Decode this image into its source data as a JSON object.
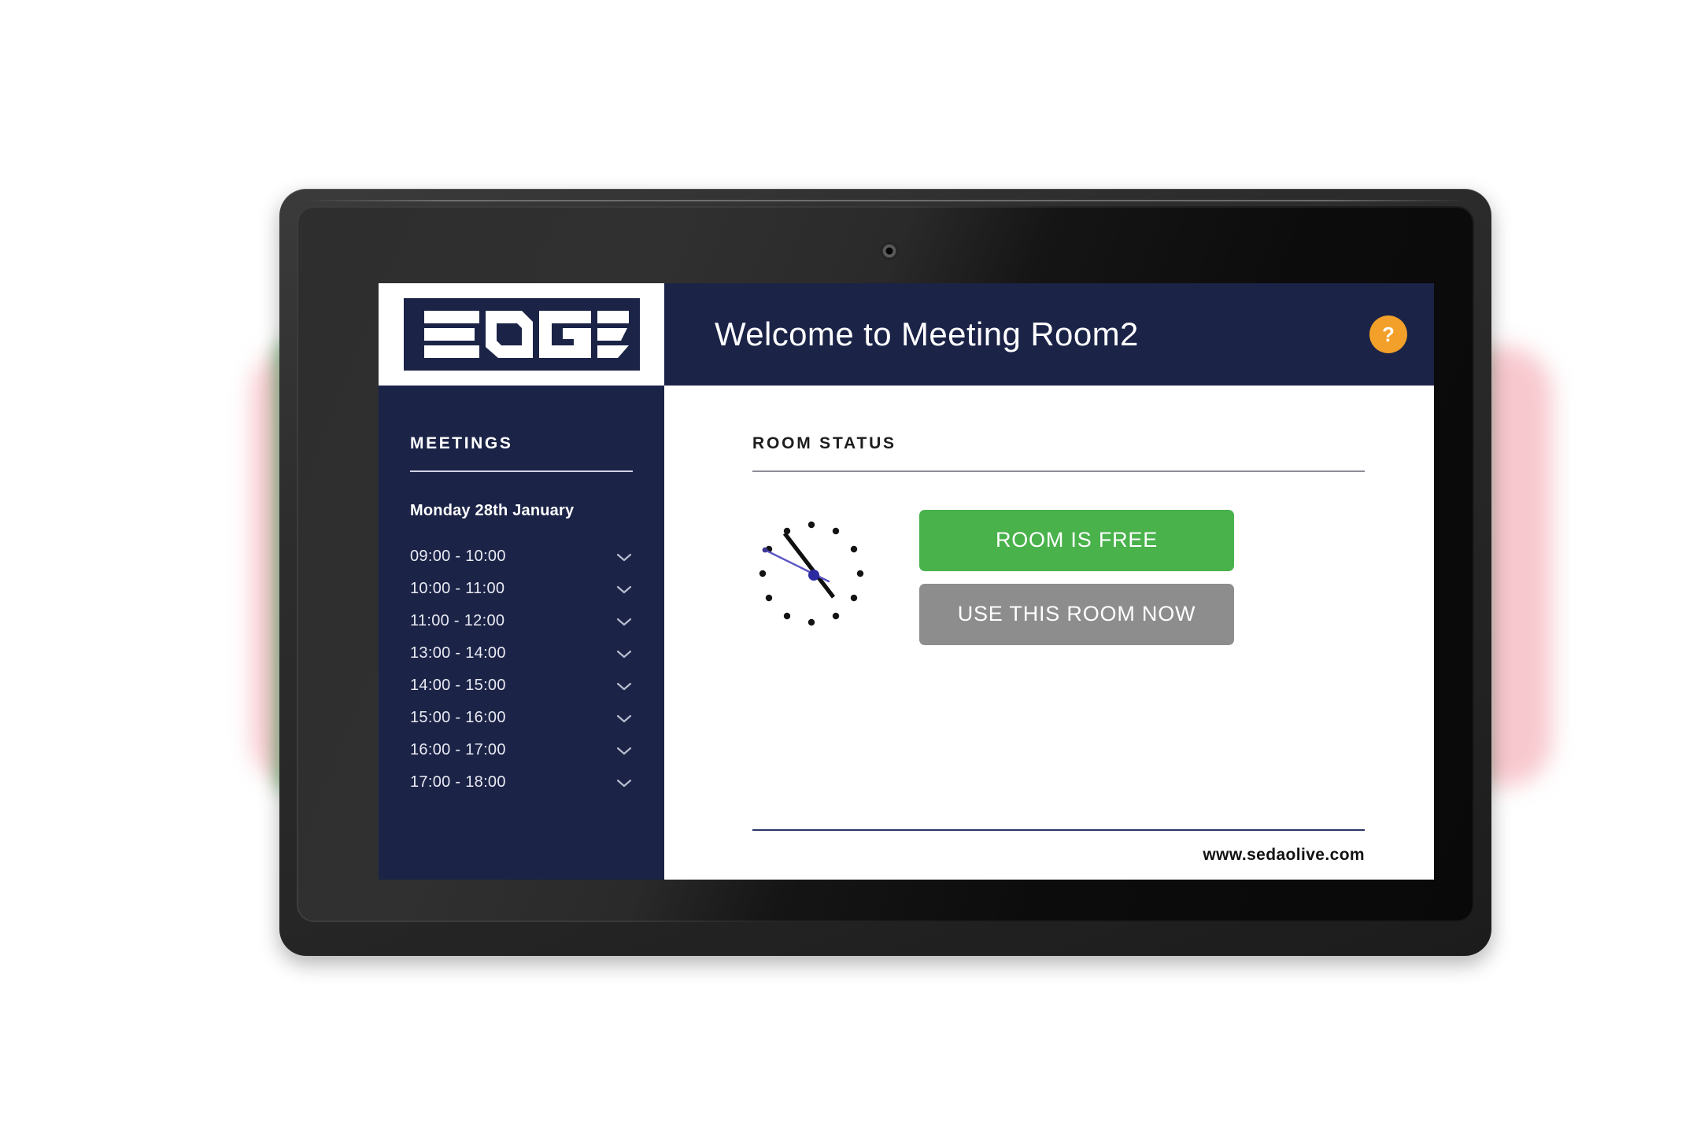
{
  "device": {
    "type": "tablet-meeting-room-panel",
    "led_status_color": "#1ec94d",
    "glow_color": "#f7c6cc"
  },
  "brand": {
    "logo_text": "EDGE",
    "logo_icon": "edge-wordmark-logo"
  },
  "header": {
    "title": "Welcome to Meeting Room2",
    "help_label": "?",
    "help_icon": "question-mark-icon",
    "background_color": "#1b2347",
    "help_color": "#f2a029"
  },
  "sidebar": {
    "title": "MEETINGS",
    "date": "Monday 28th January",
    "chevron_icon": "chevron-down-icon",
    "slots": [
      {
        "time": "09:00 - 10:00"
      },
      {
        "time": "10:00 - 11:00"
      },
      {
        "time": "11:00 - 12:00"
      },
      {
        "time": "13:00 - 14:00"
      },
      {
        "time": "14:00 - 15:00"
      },
      {
        "time": "15:00 - 16:00"
      },
      {
        "time": "16:00 - 17:00"
      },
      {
        "time": "17:00 - 18:00"
      }
    ]
  },
  "main": {
    "section_title": "ROOM STATUS",
    "clock_icon": "analog-clock-icon",
    "status_button": {
      "label": "ROOM IS FREE",
      "color": "#49b24b"
    },
    "action_button": {
      "label": "USE THIS ROOM NOW",
      "color": "#8d8d8d"
    }
  },
  "footer": {
    "url": "www.sedaolive.com"
  }
}
